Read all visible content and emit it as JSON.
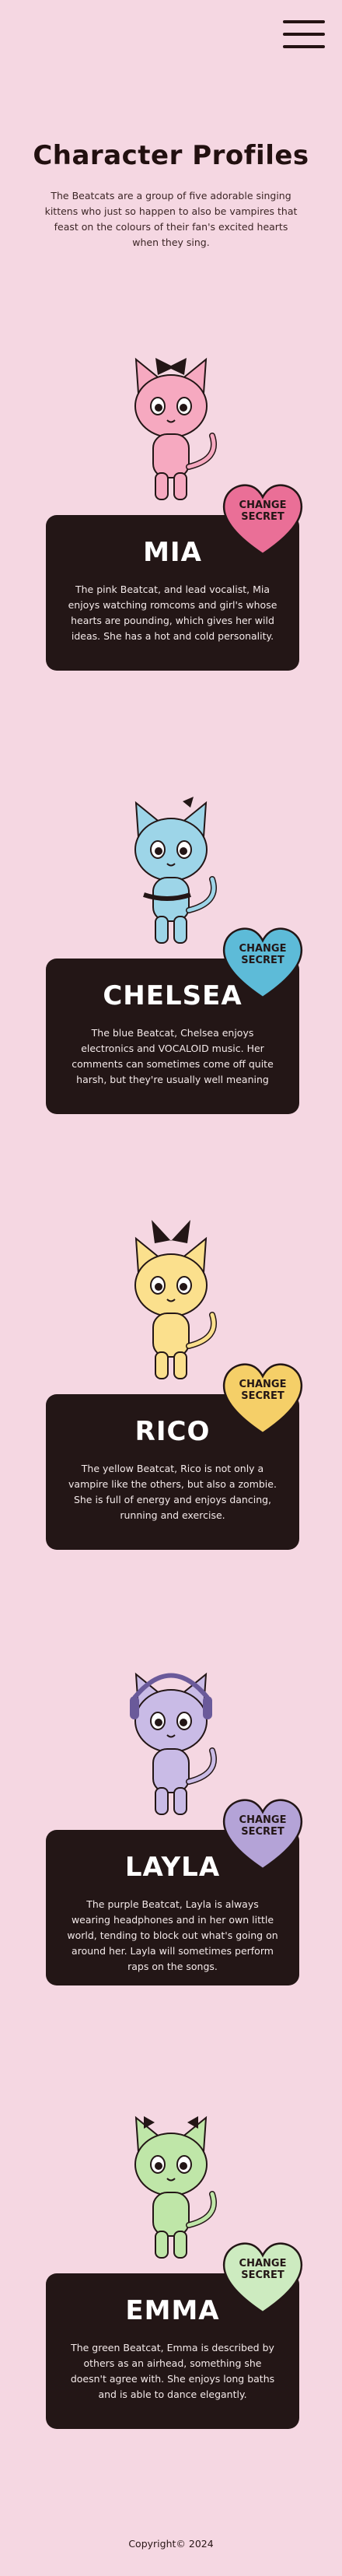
{
  "nav": {
    "menu_icon": "hamburger-icon"
  },
  "hero": {
    "title": "Character Profiles",
    "intro": "The Beatcats are a group of five adorable singing kittens who just so happen to also be vampires that feast on the colours of their fan's excited hearts when they sing."
  },
  "characters": [
    {
      "name": "MIA",
      "description": "The pink Beatcat, and lead vocalist, Mia enjoys watching romcoms and girl's whose hearts are pounding, which gives her wild ideas. She has a hot and cold personality.",
      "button_label": "CHANGE SECRET",
      "accent": "#ea6f97",
      "fur": "#f6a9c0"
    },
    {
      "name": "CHELSEA",
      "description": "The blue Beatcat, Chelsea enjoys electronics and VOCALOID music. Her comments can sometimes come off quite harsh, but they're usually well meaning",
      "button_label": "CHANGE SECRET",
      "accent": "#5dbbd8",
      "fur": "#9dd5e8"
    },
    {
      "name": "RICO",
      "description": "The yellow Beatcat, Rico is not only a vampire like the others, but also a zombie. She is full of energy and enjoys dancing, running and exercise.",
      "button_label": "CHANGE SECRET",
      "accent": "#f5cf68",
      "fur": "#fbe08d"
    },
    {
      "name": "LAYLA",
      "description": "The purple Beatcat, Layla is always wearing headphones and in her own little world, tending to block out what's going on around her. Layla will sometimes perform raps on the songs.",
      "button_label": "CHANGE SECRET",
      "accent": "#b4a3d7",
      "fur": "#c9bbe6"
    },
    {
      "name": "EMMA",
      "description": "The green Beatcat, Emma is described by others as an airhead, something she doesn't agree with. She enjoys long baths and is able to dance elegantly.",
      "button_label": "CHANGE SECRET",
      "accent": "#cdebc0",
      "fur": "#bfe6a8"
    }
  ],
  "footer": {
    "copyright": "Copyright© 2024"
  }
}
